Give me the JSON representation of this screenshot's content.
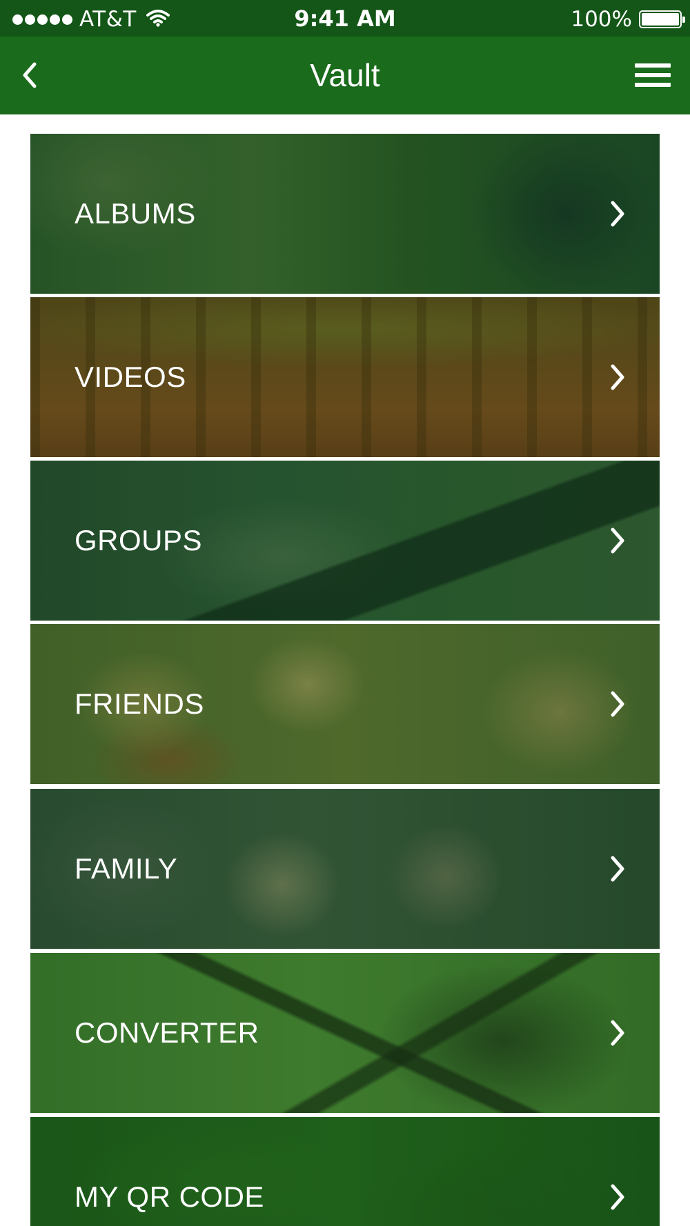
{
  "status_bar": {
    "carrier": "AT&T",
    "time": "9:41 AM",
    "battery": "100%",
    "signal_icon": "signal-dots-icon",
    "wifi_icon": "wifi-icon",
    "battery_icon": "battery-full-icon"
  },
  "nav": {
    "title": "Vault",
    "back_icon": "chevron-left-icon",
    "menu_icon": "hamburger-menu-icon"
  },
  "colors": {
    "status_bar": "#135617",
    "nav_bar": "#1a6b1c",
    "text": "#ffffff"
  },
  "menu": {
    "items": [
      {
        "label": "ALBUMS",
        "icon": "chevron-right-icon"
      },
      {
        "label": "VIDEOS",
        "icon": "chevron-right-icon"
      },
      {
        "label": "GROUPS",
        "icon": "chevron-right-icon"
      },
      {
        "label": "FRIENDS",
        "icon": "chevron-right-icon"
      },
      {
        "label": "FAMILY",
        "icon": "chevron-right-icon"
      },
      {
        "label": "CONVERTER",
        "icon": "chevron-right-icon"
      },
      {
        "label": "MY QR CODE",
        "icon": "chevron-right-icon"
      }
    ]
  }
}
